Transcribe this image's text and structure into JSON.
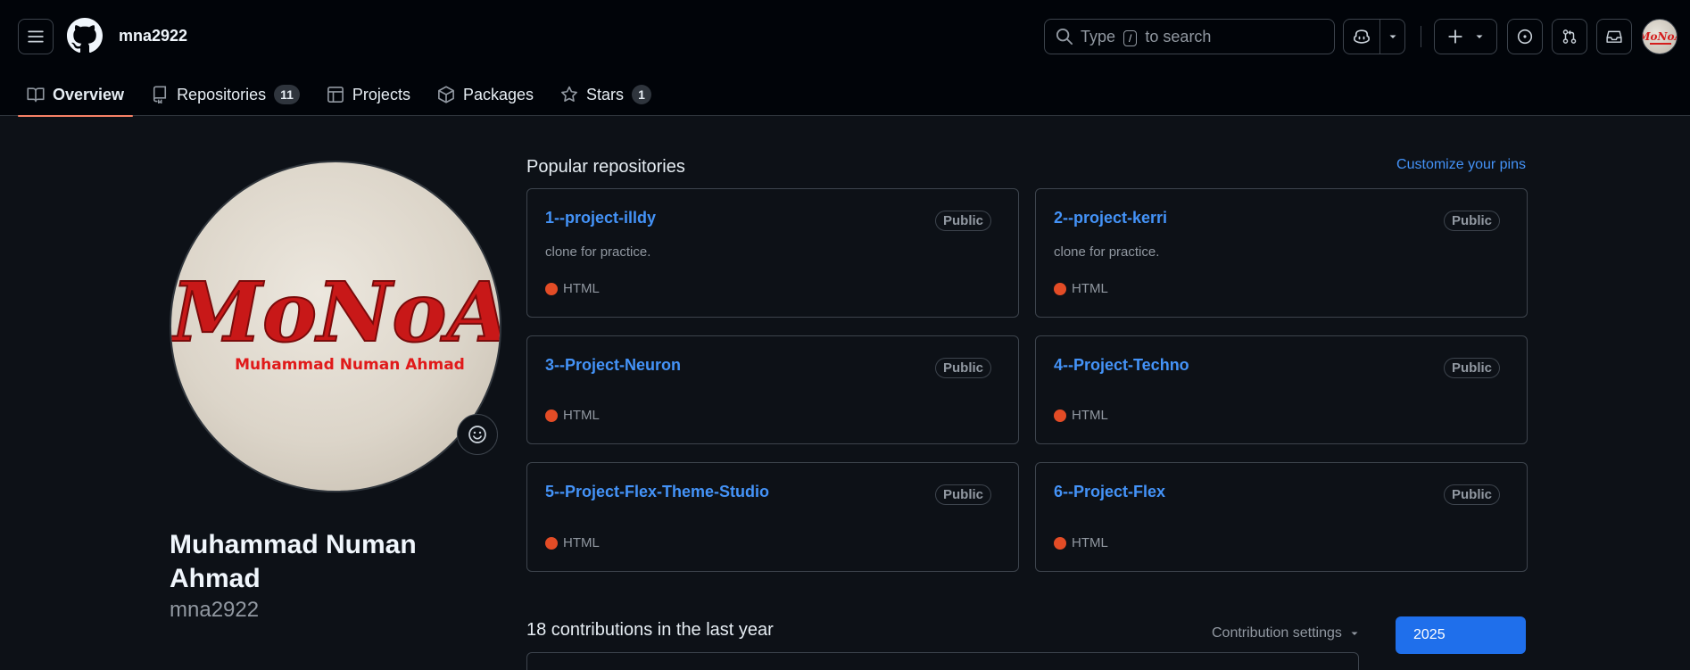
{
  "header": {
    "username": "mna2922",
    "search": {
      "prefix": "Type",
      "key": "/",
      "suffix": "to search"
    }
  },
  "tabs": [
    {
      "label": "Overview",
      "icon": "book-icon",
      "active": true
    },
    {
      "label": "Repositories",
      "icon": "repo-icon",
      "count": "11"
    },
    {
      "label": "Projects",
      "icon": "table-icon"
    },
    {
      "label": "Packages",
      "icon": "package-icon"
    },
    {
      "label": "Stars",
      "icon": "star-icon",
      "count": "1"
    }
  ],
  "profile": {
    "avatar_text": "MoNoA",
    "avatar_subtext": "Muhammad Numan Ahmad",
    "full_name": "Muhammad Numan Ahmad",
    "login": "mna2922"
  },
  "popular": {
    "title": "Popular repositories",
    "customize_label": "Customize your pins",
    "repos": [
      {
        "name": "1--project-illdy",
        "visibility": "Public",
        "description": "clone for practice.",
        "language": "HTML",
        "lang_color": "#e34c26"
      },
      {
        "name": "2--project-kerri",
        "visibility": "Public",
        "description": "clone for practice.",
        "language": "HTML",
        "lang_color": "#e34c26"
      },
      {
        "name": "3--Project-Neuron",
        "visibility": "Public",
        "description": "",
        "language": "HTML",
        "lang_color": "#e34c26"
      },
      {
        "name": "4--Project-Techno",
        "visibility": "Public",
        "description": "",
        "language": "HTML",
        "lang_color": "#e34c26"
      },
      {
        "name": "5--Project-Flex-Theme-Studio",
        "visibility": "Public",
        "description": "",
        "language": "HTML",
        "lang_color": "#e34c26"
      },
      {
        "name": "6--Project-Flex",
        "visibility": "Public",
        "description": "",
        "language": "HTML",
        "lang_color": "#e34c26"
      }
    ]
  },
  "contributions": {
    "title": "18 contributions in the last year",
    "settings_label": "Contribution settings",
    "year": "2025"
  },
  "colors": {
    "accent": "#4493f8",
    "tab_underline": "#f78166",
    "primary_button": "#1f6feb",
    "html_language": "#e34c26"
  }
}
